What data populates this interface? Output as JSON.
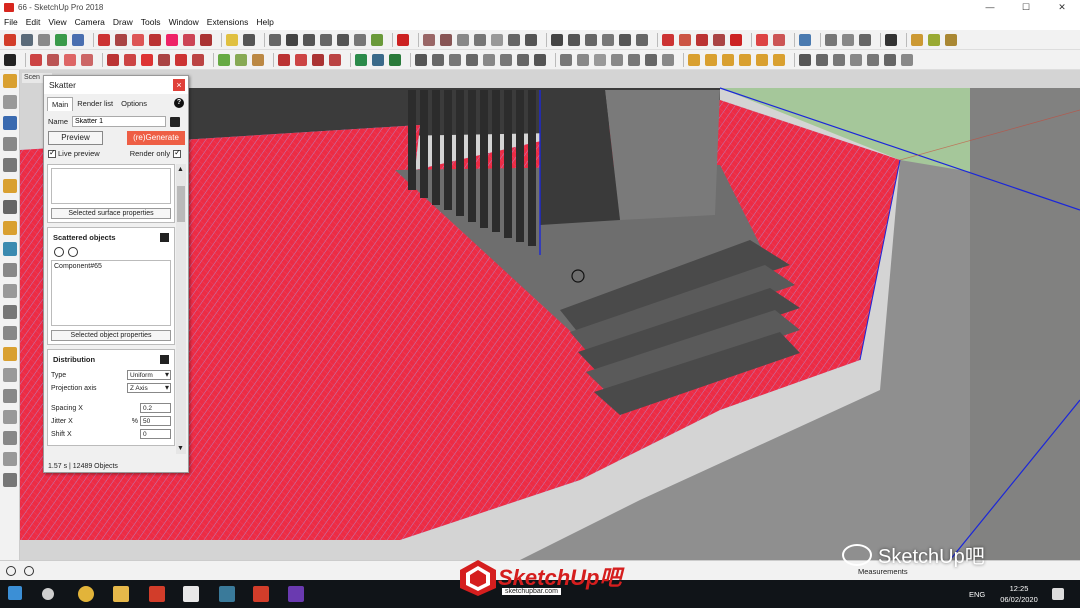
{
  "window": {
    "title": "66 - SketchUp Pro 2018",
    "controls": [
      "—",
      "☐",
      "✕"
    ]
  },
  "menu": [
    "File",
    "Edit",
    "View",
    "Camera",
    "Draw",
    "Tools",
    "Window",
    "Extensions",
    "Help"
  ],
  "scene_tab": "Scen",
  "skatter": {
    "title": "Skatter",
    "close": "×",
    "tabs": [
      "Main",
      "Render list",
      "Options"
    ],
    "help": "?",
    "name_label": "Name",
    "name_value": "Skatter 1",
    "preview_label": "Preview",
    "generate_label": "(re)Generate",
    "live_preview_label": "Live preview",
    "render_only_label": "Render only",
    "surface_props_label": "Selected surface properties",
    "scattered_title": "Scattered objects",
    "component_item": "Component#65",
    "object_props_label": "Selected object properties",
    "distribution_title": "Distribution",
    "type_label": "Type",
    "type_value": "Uniform",
    "projection_label": "Projection axis",
    "projection_value": "Z Axis",
    "spacing_label": "Spacing X",
    "spacing_value": "0.2",
    "jitter_label": "Jitter X",
    "jitter_unit": "%",
    "jitter_value": "50",
    "shift_label": "Shift X",
    "shift_value": "0",
    "status": "1.57 s | 12489 Objects"
  },
  "statusbar": {
    "measurements": "Measurements"
  },
  "taskbar": {
    "lang": "ENG",
    "time": "12:25",
    "date": "06/02/2020"
  },
  "watermark": {
    "logo_text": "SketchUp吧",
    "logo_url": "sketchupbar.com",
    "wechat_text": "SketchUp吧"
  },
  "colors": {
    "scatter_red": "#ec2c45",
    "ground_lavender": "#9fa4f2",
    "generate_btn": "#ee5e45",
    "axis_blue": "#1b27d9"
  }
}
